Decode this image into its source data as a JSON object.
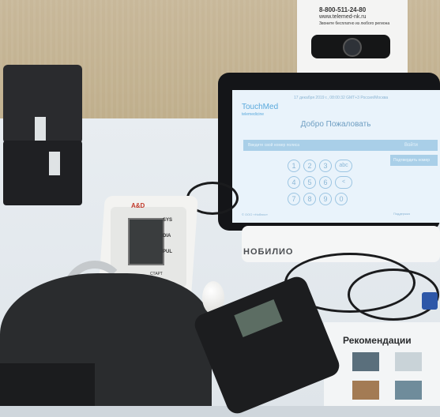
{
  "wall_poster_text": {
    "phone": "8-800-511-24-80",
    "site": "www.telemed-nk.ru",
    "line": "Звоните бесплатно из любого региона"
  },
  "monitor": {
    "brand_label": "НОБИЛИО",
    "screen": {
      "logo": "TouchMed",
      "logo_sub": "telemedicine",
      "datetime": "17 декабря 2019 г., 08:00:32 GMT+3 Россия/Москва",
      "welcome": "Добро Пожаловать",
      "input_placeholder": "Введите свой номер полиса",
      "input_button": "Войти",
      "next_button": "Подтвердить номер",
      "keypad": [
        "1",
        "2",
        "3",
        "abc",
        "4",
        "5",
        "6",
        "<",
        "7",
        "8",
        "9",
        "0"
      ],
      "footer_left": "© ООО «Ноблио»",
      "footer_right": "Поддержка"
    }
  },
  "bp_monitor": {
    "brand": "A&D",
    "labels": [
      "SYS",
      "DIA",
      "PUL"
    ],
    "start_label": "СТАРТ"
  },
  "poster": {
    "title": "Рекомендации"
  },
  "colors": {
    "screen_accent": "#a9cfe8",
    "screen_text": "#6e9ec2",
    "brand_red": "#c0392b"
  }
}
